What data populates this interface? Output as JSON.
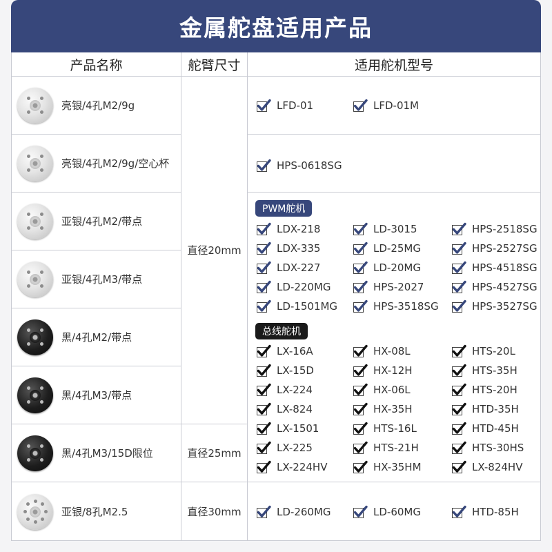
{
  "title": "金属舵盘适用产品",
  "columns": {
    "product": "产品名称",
    "arm": "舵臂尺寸",
    "models": "适用舵机型号"
  },
  "products": [
    {
      "name": "亮银/4孔M2/9g",
      "color": "silver",
      "holes": 4
    },
    {
      "name": "亮银/4孔M2/9g/空心杯",
      "color": "silver",
      "holes": 4
    },
    {
      "name": "亚银/4孔M2/带点",
      "color": "silver",
      "holes": 4
    },
    {
      "name": "亚银/4孔M3/带点",
      "color": "silver",
      "holes": 4
    },
    {
      "name": "黑/4孔M2/带点",
      "color": "black",
      "holes": 4
    },
    {
      "name": "黑/4孔M3/带点",
      "color": "black",
      "holes": 4
    },
    {
      "name": "黑/4孔M3/15D限位",
      "color": "black",
      "holes": 4
    },
    {
      "name": "亚银/8孔M2.5",
      "color": "silver",
      "holes": 8
    }
  ],
  "arm_sizes": [
    "直径20mm",
    "直径25mm",
    "直径30mm"
  ],
  "models": {
    "row1": [
      "LFD-01",
      "LFD-01M"
    ],
    "row2": [
      "HPS-0618SG"
    ],
    "pwm_label": "PWM舵机",
    "pwm": [
      [
        "LDX-218",
        "LD-3015",
        "HPS-2518SG"
      ],
      [
        "LDX-335",
        "LD-25MG",
        "HPS-2527SG"
      ],
      [
        "LDX-227",
        "LD-20MG",
        "HPS-4518SG"
      ],
      [
        "LD-220MG",
        "HPS-2027",
        "HPS-4527SG"
      ],
      [
        "LD-1501MG",
        "HPS-3518SG",
        "HPS-3527SG"
      ]
    ],
    "bus_label": "总线舵机",
    "bus": [
      [
        "LX-16A",
        "HX-08L",
        "HTS-20L"
      ],
      [
        "LX-15D",
        "HX-12H",
        "HTS-35H"
      ],
      [
        "LX-224",
        "HX-06L",
        "HTS-20H"
      ],
      [
        "LX-824",
        "HX-35H",
        "HTD-35H"
      ],
      [
        "LX-1501",
        "HTS-16L",
        "HTD-45H"
      ],
      [
        "LX-225",
        "HTS-21H",
        "HTS-30HS"
      ],
      [
        "LX-224HV",
        "HX-35HM",
        "LX-824HV"
      ]
    ],
    "row8": [
      "LD-260MG",
      "LD-60MG",
      "HTD-85H"
    ]
  },
  "colors": {
    "header_bg": "#37477b",
    "pwm_tag": "#37477b",
    "bus_tag": "#1a1a1a",
    "check_blue": "#37477b",
    "check_black": "#111111"
  },
  "icons": {
    "check": "checkbox-checked-icon",
    "disc": "servo-horn-disc-icon"
  }
}
